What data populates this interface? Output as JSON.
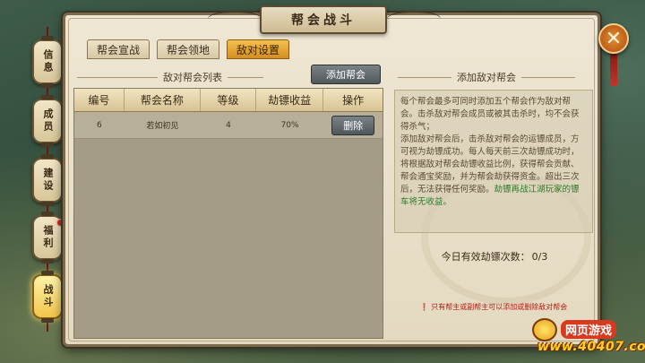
{
  "window": {
    "title": "帮会战斗",
    "close_icon": "close-x-icon"
  },
  "side_nav": [
    {
      "label": "信息",
      "active": false,
      "badge": false
    },
    {
      "label": "成员",
      "active": false,
      "badge": false
    },
    {
      "label": "建设",
      "active": false,
      "badge": false
    },
    {
      "label": "福利",
      "active": false,
      "badge": true
    },
    {
      "label": "战斗",
      "active": true,
      "badge": false
    }
  ],
  "tabs": [
    {
      "label": "帮会宣战",
      "active": false
    },
    {
      "label": "帮会领地",
      "active": false
    },
    {
      "label": "敌对设置",
      "active": true
    }
  ],
  "left": {
    "section_title": "敌对帮会列表",
    "add_button": "添加帮会",
    "columns": [
      "编号",
      "帮会名称",
      "等级",
      "劫镖收益",
      "操作"
    ],
    "rows": [
      {
        "id": "6",
        "name": "若如初见",
        "level": "4",
        "income": "70%",
        "action": "删除"
      }
    ]
  },
  "right": {
    "section_title": "添加敌对帮会",
    "info_lines": [
      "每个帮会最多可同时添加五个帮会作为敌对帮会。击杀敌对帮会成员或被其击杀时，均不会获得杀气；",
      "添加敌对帮会后，击杀敌对帮会的运镖成员，方可视为劫镖成功。每人每天前三次劫镖成功时，将根据敌对帮会劫镖收益比例，获得帮会贡献、帮会通宝奖励，并为帮会劫获得资金。超出三次后，无法获得任何奖励。"
    ],
    "info_green": "劫镖再战江湖玩家的镖车将无收益。",
    "daily_label": "今日有效劫镖次数：",
    "daily_value": "0/3",
    "note": "只有帮主或副帮主可以添加或删除敌对帮会"
  },
  "watermark": {
    "top": "网页游戏",
    "bottom": "www.40407.com"
  },
  "colors": {
    "active_tab": "#e0a030",
    "note_red": "#b21e16",
    "info_green": "#2b7a28"
  }
}
